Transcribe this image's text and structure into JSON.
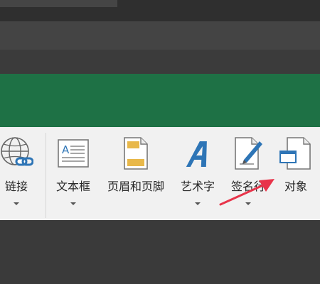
{
  "ribbon": {
    "commands": [
      {
        "id": "link",
        "label": "链接",
        "icon": "globe-link-icon"
      },
      {
        "id": "textbox",
        "label": "文本框",
        "icon": "textbox-icon"
      },
      {
        "id": "header-footer",
        "label": "页眉和页脚",
        "icon": "header-footer-icon"
      },
      {
        "id": "wordart",
        "label": "艺术字",
        "icon": "wordart-icon"
      },
      {
        "id": "signature",
        "label": "签名行",
        "icon": "signature-line-icon"
      },
      {
        "id": "object",
        "label": "对象",
        "icon": "object-icon"
      }
    ]
  },
  "colors": {
    "accent_green": "#1e7145",
    "ribbon_bg": "#f1f1f1",
    "annotation_arrow": "#e8344a",
    "wordart_blue": "#2e75b6"
  }
}
